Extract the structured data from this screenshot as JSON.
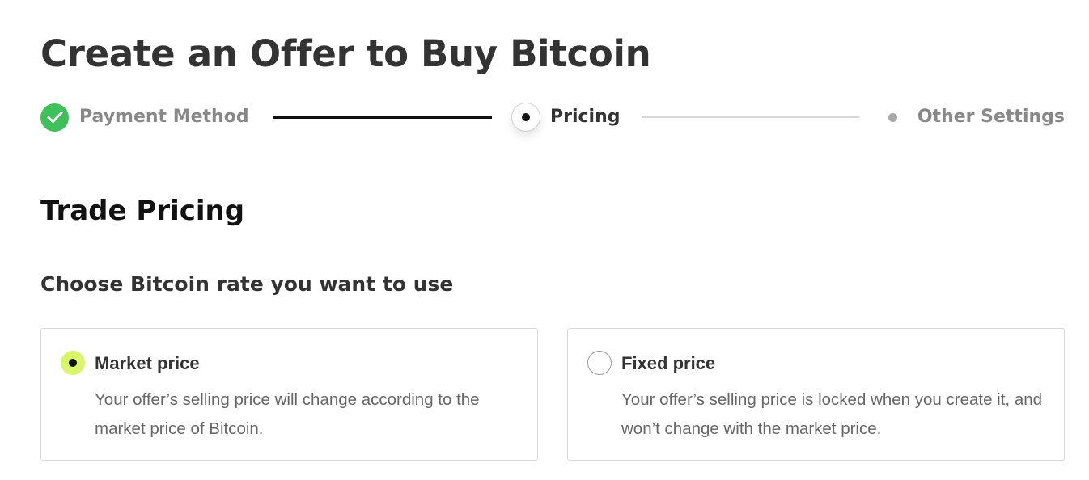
{
  "page": {
    "title": "Create an Offer to Buy Bitcoin"
  },
  "stepper": {
    "steps": [
      {
        "label": "Payment Method",
        "state": "completed",
        "icon": "check-icon"
      },
      {
        "label": "Pricing",
        "state": "current",
        "icon": "current-step-dot-icon"
      },
      {
        "label": "Other Settings",
        "state": "pending",
        "icon": "pending-step-dot-icon"
      }
    ]
  },
  "section": {
    "title": "Trade Pricing",
    "subtitle": "Choose Bitcoin rate you want to use"
  },
  "rate_options": [
    {
      "title": "Market price",
      "description": "Your offer’s selling price will change according to the market price of Bitcoin.",
      "selected": true
    },
    {
      "title": "Fixed price",
      "description": "Your offer’s selling price is locked when you create it, and won’t change with the market price.",
      "selected": false
    }
  ],
  "colors": {
    "completed_green": "#3fc05a",
    "selected_radio": "#d9f56a",
    "text_dark": "#333333",
    "text_muted": "#888888",
    "border": "#d9d9d9"
  }
}
